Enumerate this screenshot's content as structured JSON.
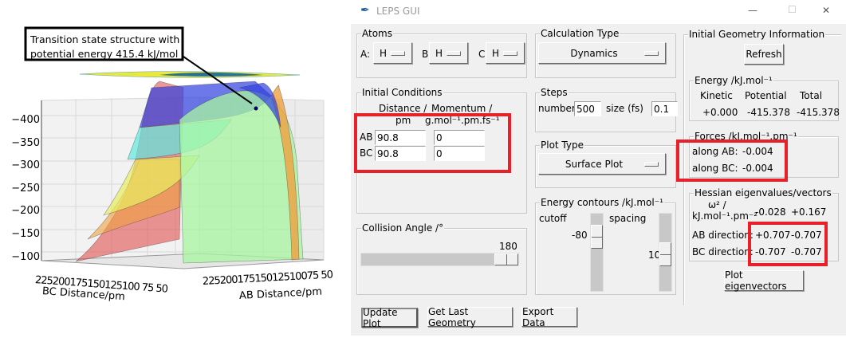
{
  "plot": {
    "annotation": "Transition state structure with potential energy 415.4 kJ/mol",
    "z_ticks": [
      "−400",
      "−350",
      "−300",
      "−250",
      "−200",
      "−150",
      "−100"
    ],
    "bc_ticks": [
      "225",
      "200",
      "175",
      "150",
      "125",
      "100",
      "75",
      "50"
    ],
    "ab_ticks": [
      "225",
      "200",
      "175",
      "150",
      "125",
      "100",
      "75",
      "50"
    ],
    "bc_label": "BC Distance/pm",
    "ab_label": "AB Distance/pm"
  },
  "window": {
    "title": "LEPS GUI",
    "minimize": "—",
    "maximize": "☐",
    "close": "✕"
  },
  "atoms": {
    "title": "Atoms",
    "a_label": "A:",
    "a_value": "H",
    "b_label": "B:",
    "b_value": "H",
    "c_label": "C:",
    "c_value": "H"
  },
  "calc_type": {
    "title": "Calculation Type",
    "value": "Dynamics"
  },
  "initial_conditions": {
    "title": "Initial Conditions",
    "distance_header_1": "Distance /",
    "distance_header_2": "pm",
    "momentum_header_1": "Momentum /",
    "momentum_header_2": "g.mol⁻¹.pm.fs⁻¹",
    "rows": [
      {
        "label": "AB",
        "distance": "90.8",
        "momentum": "0"
      },
      {
        "label": "BC",
        "distance": "90.8",
        "momentum": "0"
      }
    ]
  },
  "steps": {
    "title": "Steps",
    "number_label": "number",
    "number_value": "500",
    "size_label": "size (fs)",
    "size_value": "0.1"
  },
  "plot_type": {
    "title": "Plot Type",
    "value": "Surface Plot"
  },
  "collision": {
    "title": "Collision Angle /°",
    "value": "180",
    "fraction": 1.0
  },
  "contours": {
    "title": "Energy contours /kJ.mol⁻¹",
    "cutoff_label": "cutoff",
    "cutoff_value": "-80",
    "spacing_label": "spacing",
    "spacing_value": "10"
  },
  "buttons": {
    "update": "Update Plot",
    "last_geometry": "Get Last Geometry",
    "export": "Export Data"
  },
  "geometry_info": {
    "title": "Initial Geometry Information",
    "refresh": "Refresh",
    "energy": {
      "title": "Energy /kJ.mol⁻¹",
      "headers": [
        "Kinetic",
        "Potential",
        "Total"
      ],
      "values": [
        "+0.000",
        "-415.378",
        "-415.378"
      ]
    },
    "forces": {
      "title": "Forces /kJ.mol⁻¹.pm⁻¹",
      "ab_label": "along AB:",
      "ab_value": "-0.004",
      "bc_label": "along BC:",
      "bc_value": "-0.004"
    },
    "hessian": {
      "title": "Hessian eigenvalues/vectors",
      "omega_label_1": "ω² /",
      "omega_label_2": "kJ.mol⁻¹.pm⁻²",
      "eigenvalues": [
        "-0.028",
        "+0.167"
      ],
      "ab_label": "AB direction:",
      "ab_values": [
        "+0.707",
        "-0.707"
      ],
      "bc_label": "BC direction:",
      "bc_values": [
        "-0.707",
        "-0.707"
      ]
    },
    "plot_eigenvectors": "Plot eigenvectors"
  }
}
